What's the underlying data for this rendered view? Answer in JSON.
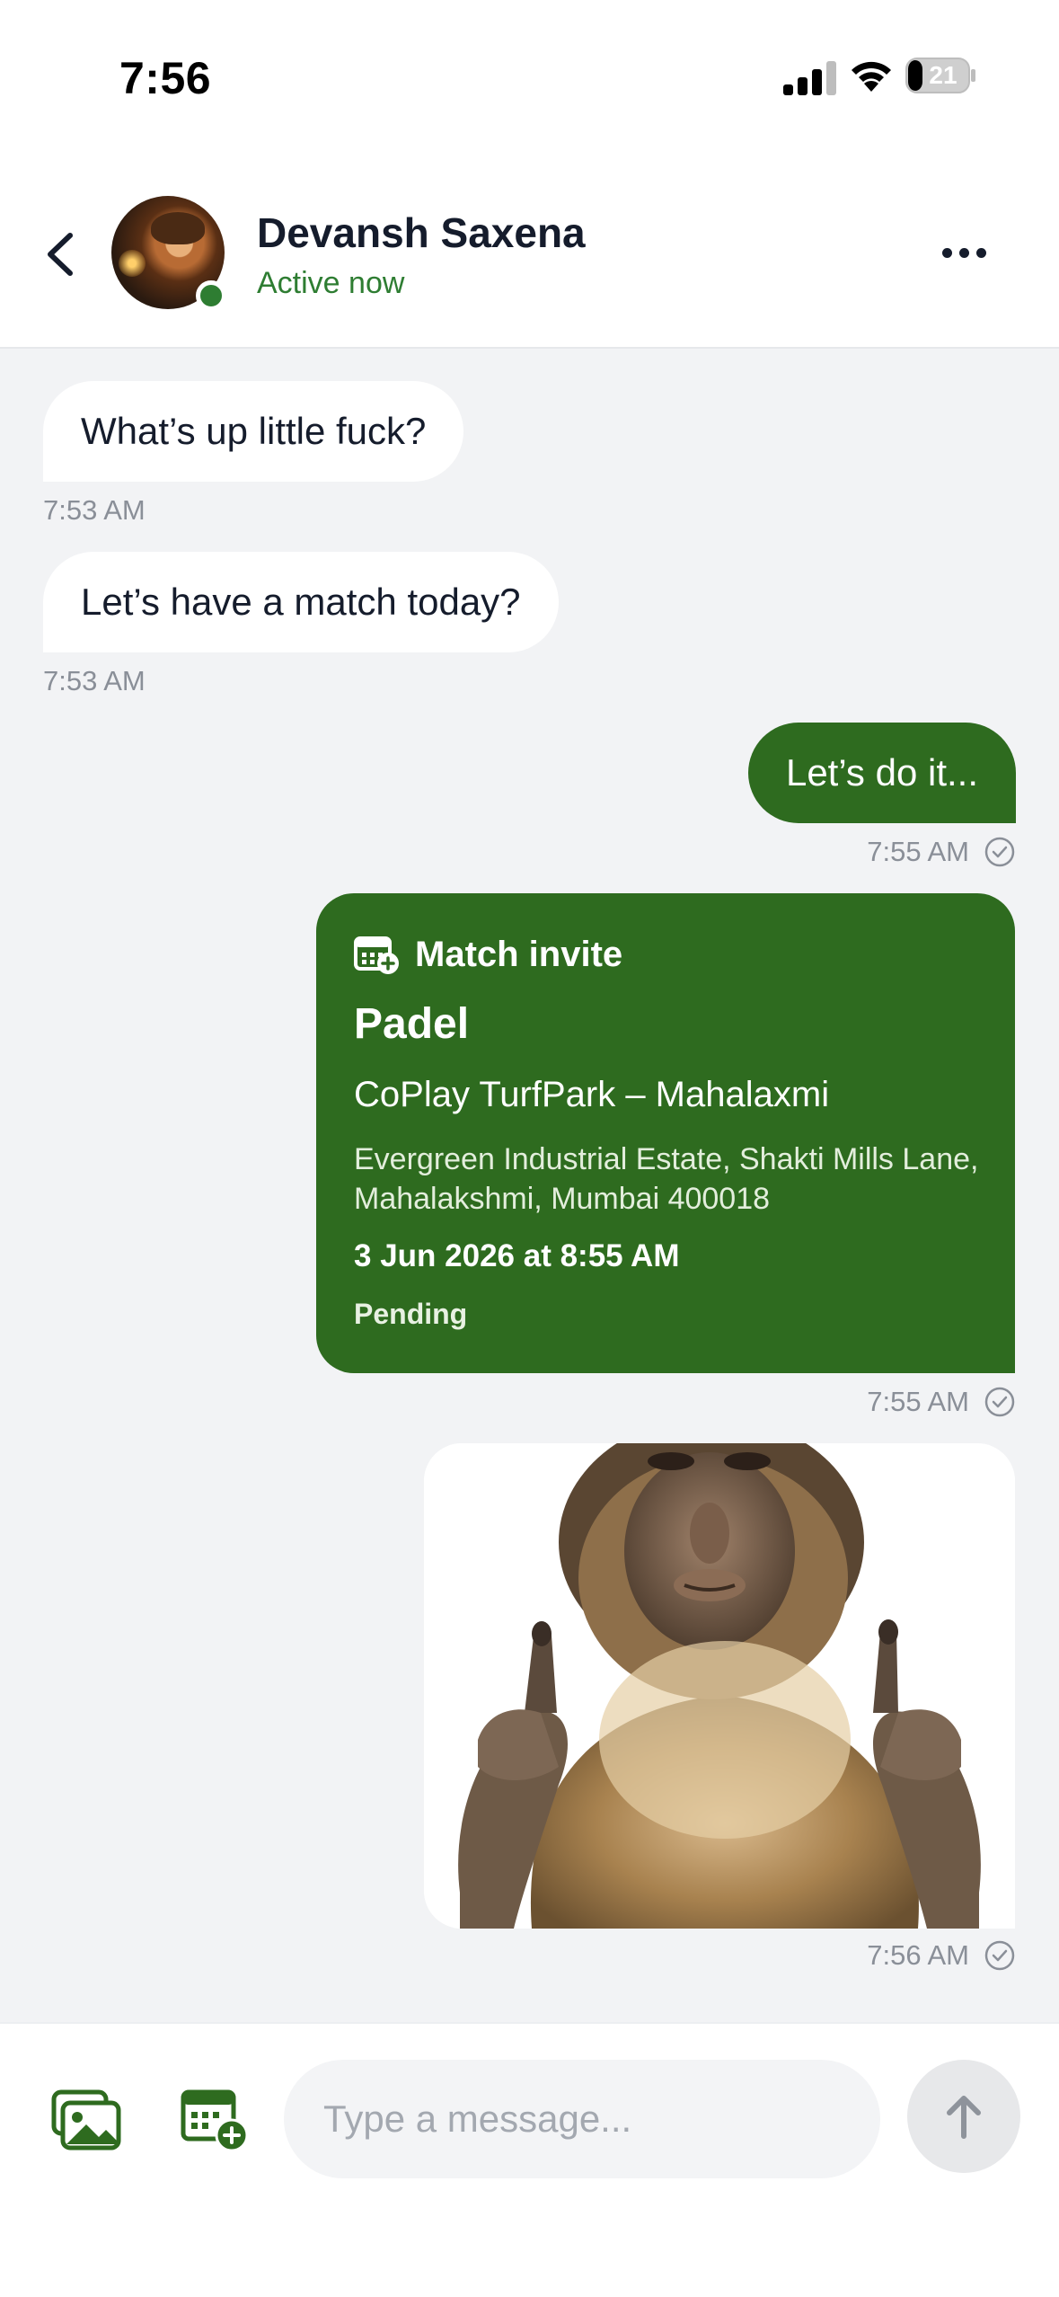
{
  "status_bar": {
    "time": "7:56",
    "battery_level": "21",
    "icons": [
      "signal-icon",
      "wifi-icon",
      "battery-icon"
    ]
  },
  "header": {
    "contact_name": "Devansh Saxena",
    "contact_status": "Active now",
    "icons": [
      "back-arrow-icon",
      "more-options-icon"
    ]
  },
  "messages": [
    {
      "direction": "incoming",
      "text": "What’s up little fuck?",
      "time": "7:53 AM"
    },
    {
      "direction": "incoming",
      "text": "Let’s have a match today?",
      "time": "7:53 AM"
    },
    {
      "direction": "outgoing",
      "text": "Let’s do it...",
      "time": "7:55 AM",
      "read_icon": "check-circle-icon"
    },
    {
      "direction": "outgoing",
      "type": "match_invite",
      "tag": "Match invite",
      "sport": "Padel",
      "venue": "CoPlay TurfPark – Mahalaxmi",
      "address": "Evergreen Industrial Estate, Shakti Mills Lane, Mahalakshmi, Mumbai 400018",
      "datetime": "3 Jun 2026 at 8:55 AM",
      "status": "Pending",
      "time": "7:55 AM",
      "icon": "calendar-plus-icon"
    },
    {
      "direction": "outgoing",
      "type": "image",
      "image_desc": "monkey-gesture-sticker",
      "time": "7:56 AM"
    }
  ],
  "composer": {
    "placeholder": "Type a message...",
    "value": "",
    "icons": [
      "gallery-icon",
      "calendar-plus-icon",
      "send-arrow-icon"
    ]
  },
  "colors": {
    "accent": "#2e6b1f",
    "online": "#2e7d32",
    "background": "#f2f3f5"
  }
}
